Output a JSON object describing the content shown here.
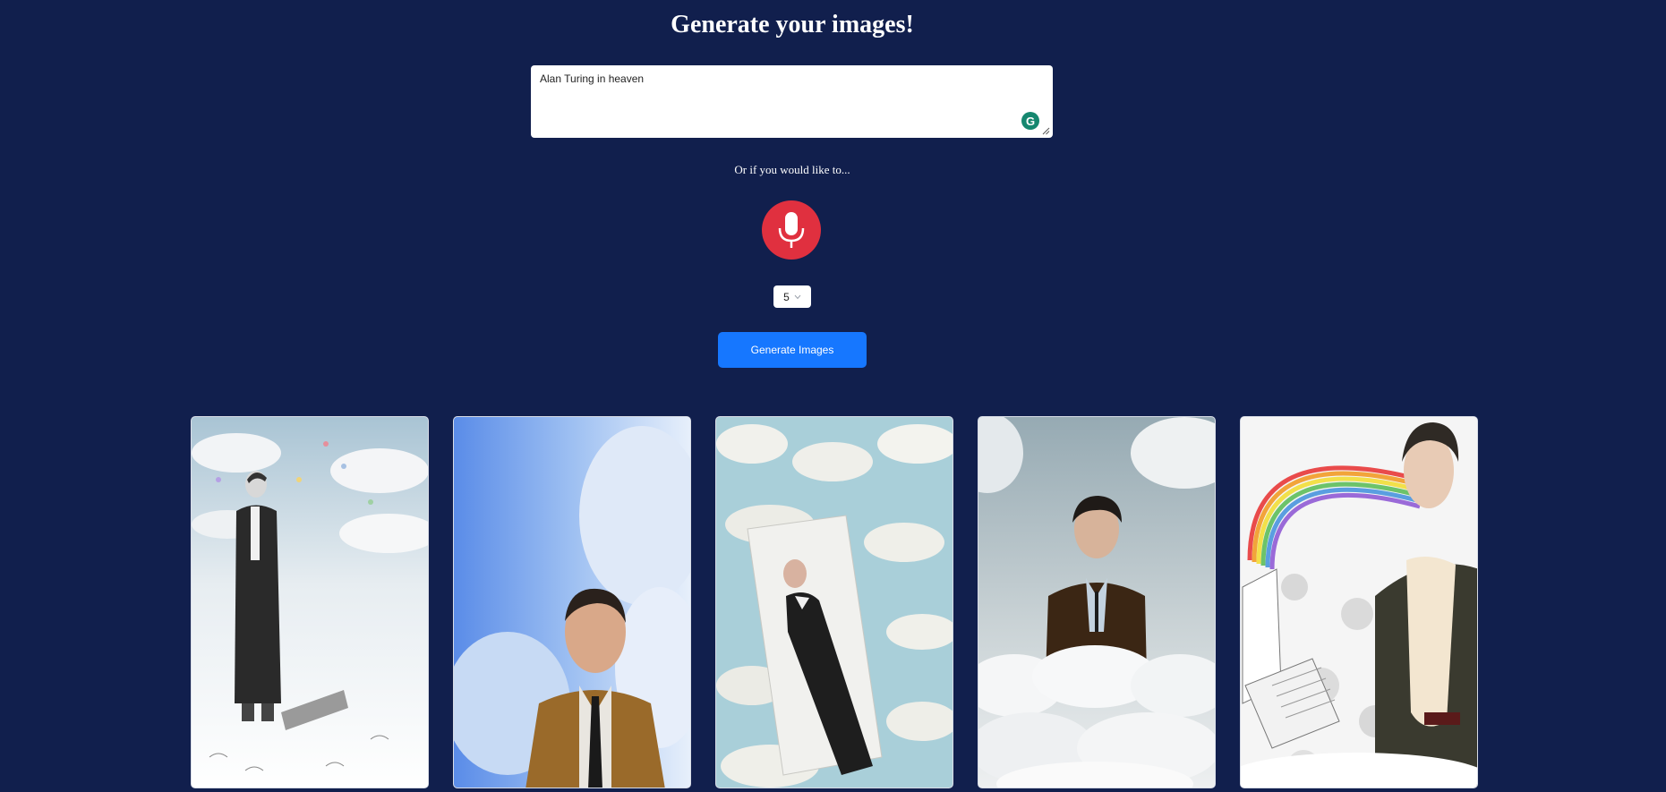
{
  "header": {
    "title": "Generate your images!"
  },
  "prompt": {
    "value": "Alan Turing in heaven",
    "grammarly_icon": "grammarly-icon",
    "grammarly_letter": "G"
  },
  "alternative": {
    "text": "Or if you would like to..."
  },
  "mic": {
    "icon": "microphone-icon",
    "color": "#e0303f"
  },
  "count_select": {
    "value": "5",
    "chevron": "chevron-down-icon"
  },
  "generate": {
    "label": "Generate Images",
    "color": "#1677ff"
  },
  "gallery": {
    "images": [
      {
        "subject": "sketch of man in suit among clouds and confetti"
      },
      {
        "subject": "man in brown jacket with blue sky and clouds"
      },
      {
        "subject": "man in black suit lying on card among clouds"
      },
      {
        "subject": "man in brown sweater emerging from clouds"
      },
      {
        "subject": "man in jacket with rainbow and clouds"
      }
    ]
  },
  "colors": {
    "background": "#111f4d",
    "accent": "#1677ff"
  }
}
